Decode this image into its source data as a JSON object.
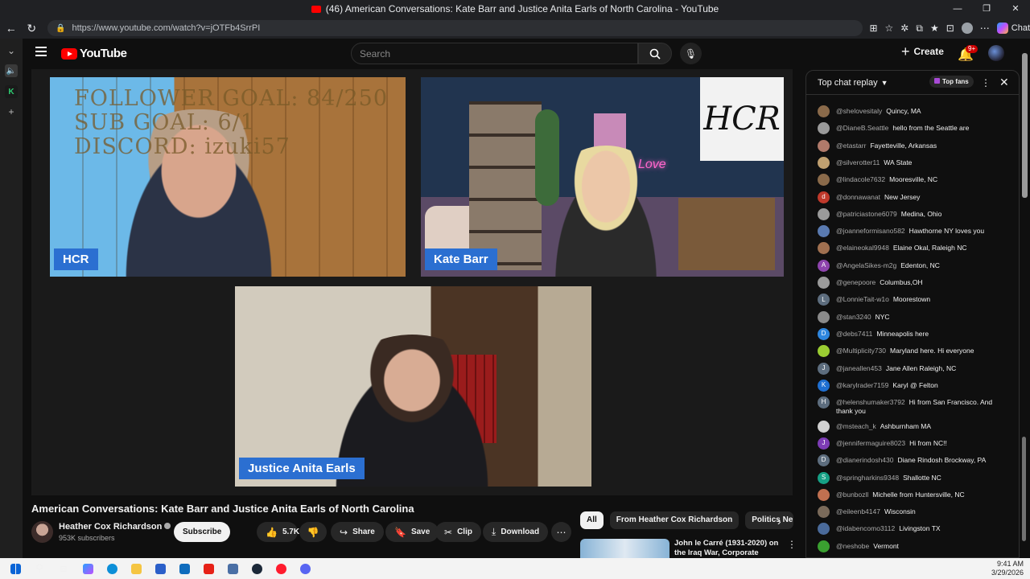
{
  "browser": {
    "tab_title": "(46) American Conversations: Kate Barr and Justice Anita Earls of North Carolina - YouTube",
    "url": "https://www.youtube.com/watch?v=jOTFb4SrrPI",
    "chat_label": "Chat",
    "window_controls": [
      "—",
      "❐",
      "✕"
    ]
  },
  "youtube": {
    "logo_text": "YouTube",
    "search_placeholder": "Search",
    "create_label": "Create",
    "notifications_badge": "9+"
  },
  "player": {
    "overlay_lines": [
      "FOLLOWER GOAL:  84/250",
      "SUB GOAL: 6/1",
      "DISCORD: izuki57"
    ],
    "tiles": [
      {
        "label": "HCR"
      },
      {
        "label": "Kate Barr",
        "sign_text": "HCR",
        "neon_text": "Love"
      },
      {
        "label": "Justice Anita Earls"
      }
    ]
  },
  "video": {
    "title": "American Conversations: Kate Barr and Justice Anita Earls of North Carolina",
    "channel_name": "Heather Cox Richardson",
    "subscribers": "953K subscribers",
    "subscribe_label": "Subscribe",
    "likes": "5.7K",
    "share_label": "Share",
    "save_label": "Save",
    "clip_label": "Clip",
    "download_label": "Download"
  },
  "recommendations": {
    "chips": [
      "All",
      "From Heather Cox Richardson",
      "Politics Ne"
    ],
    "first_title": "John le Carré (1931-2020) on the Iraq War, Corporate Power"
  },
  "chat": {
    "header": "Top chat replay",
    "top_fans_label": "Top fans",
    "messages": [
      {
        "author": "@shelovesitaly",
        "text": "Quincy, MA",
        "color": "#8a6a4a",
        "initial": ""
      },
      {
        "author": "@DianeB.Seattle",
        "text": "hello from the Seattle are",
        "color": "#9a9a9a",
        "initial": ""
      },
      {
        "author": "@etastarr",
        "text": "Fayetteville, Arkansas",
        "color": "#b07a6a",
        "initial": ""
      },
      {
        "author": "@silverotter11",
        "text": "WA State",
        "color": "#c0a070",
        "initial": ""
      },
      {
        "author": "@lindacole7632",
        "text": "Mooresville, NC",
        "color": "#8a6a4a",
        "initial": ""
      },
      {
        "author": "@donnawanat",
        "text": "New Jersey",
        "color": "#c0392b",
        "initial": "d"
      },
      {
        "author": "@patriciastone6079",
        "text": "Medina, Ohio",
        "color": "#9a9a9a",
        "initial": ""
      },
      {
        "author": "@joanneformisano582",
        "text": "Hawthorne NY loves you",
        "color": "#5a7ab0",
        "initial": ""
      },
      {
        "author": "@elaineokal9948",
        "text": "Elaine Okal, Raleigh NC",
        "color": "#a07050",
        "initial": ""
      },
      {
        "author": "@AngelaSikes-m2g",
        "text": "Edenton, NC",
        "color": "#8e44ad",
        "initial": "A"
      },
      {
        "author": "@genepoore",
        "text": "Columbus,OH",
        "color": "#9a9a9a",
        "initial": ""
      },
      {
        "author": "@LonnieTait-w1o",
        "text": "Moorestown",
        "color": "#5d6d7e",
        "initial": "L"
      },
      {
        "author": "@stan3240",
        "text": "NYC",
        "color": "#8a8a8a",
        "initial": ""
      },
      {
        "author": "@debs7411",
        "text": "Minneapolis here",
        "color": "#2e86de",
        "initial": "D"
      },
      {
        "author": "@Multiplicity730",
        "text": "Maryland here. Hi everyone",
        "color": "#9acd32",
        "initial": ""
      },
      {
        "author": "@janeallen453",
        "text": "Jane Allen Raleigh, NC",
        "color": "#5d6d7e",
        "initial": "J"
      },
      {
        "author": "@karylrader7159",
        "text": "Karyl @ Felton",
        "color": "#1f6fd1",
        "initial": "K"
      },
      {
        "author": "@helenshumaker3792",
        "text": "Hi from San Francisco. And thank you",
        "color": "#5d6d7e",
        "initial": "H"
      },
      {
        "author": "@msteach_k",
        "text": "Ashburnham MA",
        "color": "#d0d0d0",
        "initial": ""
      },
      {
        "author": "@jennifermaguire8023",
        "text": "Hi from NC!!",
        "color": "#7d3cb5",
        "initial": "J"
      },
      {
        "author": "@dianerindosh430",
        "text": "Diane Rindosh Brockway, PA",
        "color": "#5d6d7e",
        "initial": "D"
      },
      {
        "author": "@springharkins9348",
        "text": "Shallotte NC",
        "color": "#16a085",
        "initial": "S"
      },
      {
        "author": "@bunbozll",
        "text": "Michelle from Huntersville, NC",
        "color": "#c07050",
        "initial": ""
      },
      {
        "author": "@eileenb4147",
        "text": "Wisconsin",
        "color": "#7a6a5a",
        "initial": ""
      },
      {
        "author": "@idabencomo3112",
        "text": "Livingston TX",
        "color": "#4a6a9a",
        "initial": ""
      },
      {
        "author": "@neshobe",
        "text": "Vermont",
        "color": "#3aa030",
        "initial": ""
      }
    ]
  },
  "taskbar": {
    "time": "9:41 AM",
    "date": "3/29/2026"
  }
}
